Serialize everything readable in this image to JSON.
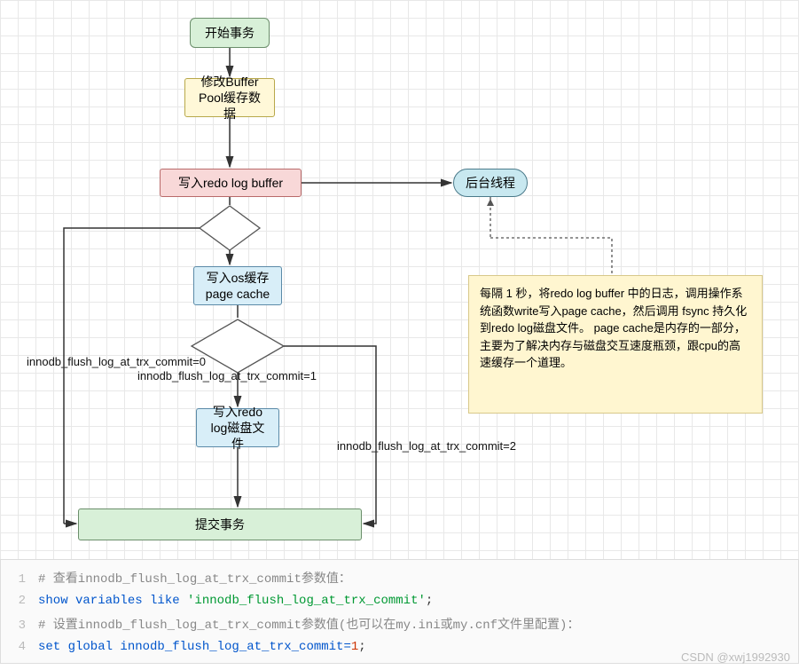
{
  "nodes": {
    "start": "开始事务",
    "modify_buffer": "修改Buffer\nPool缓存数据",
    "write_redo_buf": "写入redo log buffer",
    "bg_thread": "后台线程",
    "write_os_cache": "写入os缓存\npage cache",
    "write_disk": "写入redo\nlog磁盘文件",
    "commit": "提交事务",
    "note": "每隔 1 秒，将redo log buffer 中的日志，调用操作系统函数write写入page cache，然后调用 fsync 持久化到redo log磁盘文件。\n\npage cache是内存的一部分，主要为了解决内存与磁盘交互速度瓶颈，跟cpu的高速缓存一个道理。"
  },
  "edge_labels": {
    "commit0": "innodb_flush_log_at_trx_commit=0",
    "commit1": "innodb_flush_log_at_trx_commit=1",
    "commit2": "innodb_flush_log_at_trx_commit=2"
  },
  "code": {
    "l1_comment": "# 查看innodb_flush_log_at_trx_commit参数值：",
    "l2_show": "show variables like ",
    "l2_str": "'innodb_flush_log_at_trx_commit'",
    "l2_semi": ";",
    "l3_comment": "# 设置innodb_flush_log_at_trx_commit参数值(也可以在my.ini或my.cnf文件里配置)：",
    "l4_set": "set global innodb_flush_log_at_trx_commit=",
    "l4_val": "1",
    "l4_semi": ";"
  },
  "watermark": "CSDN @xwj1992930"
}
